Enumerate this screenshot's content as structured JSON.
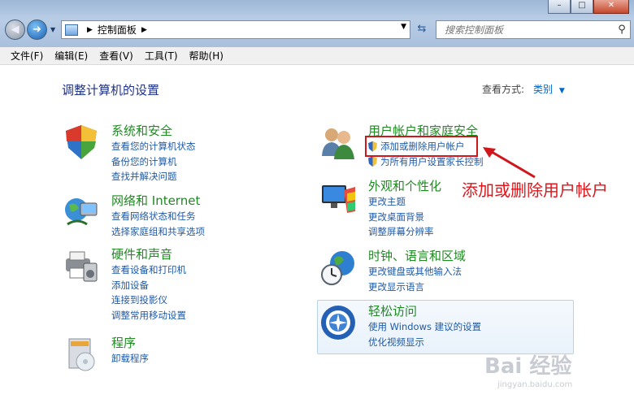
{
  "toolbar": {
    "breadcrumb": "控制面板",
    "search_placeholder": "搜索控制面板"
  },
  "menu": [
    "文件(F)",
    "编辑(E)",
    "查看(V)",
    "工具(T)",
    "帮助(H)"
  ],
  "header": {
    "title": "调整计算机的设置",
    "view_by_label": "查看方式:",
    "view_by_value": "类别"
  },
  "categories": [
    {
      "title": "系统和安全",
      "links": [
        "查看您的计算机状态",
        "备份您的计算机",
        "查找并解决问题"
      ]
    },
    {
      "title": "网络和 Internet",
      "links": [
        "查看网络状态和任务",
        "选择家庭组和共享选项"
      ]
    },
    {
      "title": "硬件和声音",
      "links": [
        "查看设备和打印机",
        "添加设备",
        "连接到投影仪",
        "调整常用移动设置"
      ]
    },
    {
      "title": "程序",
      "links": [
        "卸载程序"
      ]
    },
    {
      "title": "用户帐户和家庭安全",
      "links": [
        "添加或删除用户帐户",
        "为所有用户设置家长控制"
      ]
    },
    {
      "title": "外观和个性化",
      "links": [
        "更改主题",
        "更改桌面背景",
        "调整屏幕分辨率"
      ]
    },
    {
      "title": "时钟、语言和区域",
      "links": [
        "更改键盘或其他输入法",
        "更改显示语言"
      ]
    },
    {
      "title": "轻松访问",
      "links": [
        "使用 Windows 建议的设置",
        "优化视频显示"
      ]
    }
  ],
  "annotation": "添加或删除用户帐户",
  "watermark": {
    "brand": "Bai 经验",
    "url": "jingyan.baidu.com"
  },
  "colors": {
    "category_title": "#1f8a22",
    "link": "#1e5aa8",
    "annotation": "#e0141b",
    "page_title": "#1e3287"
  }
}
